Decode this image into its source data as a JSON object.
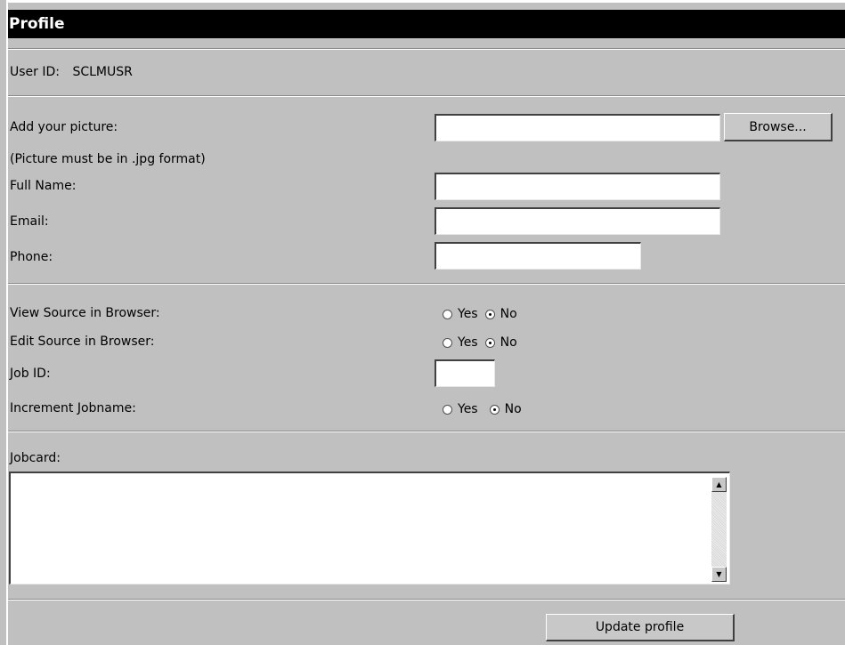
{
  "header": {
    "title": "Profile"
  },
  "user": {
    "id_label": "User ID:",
    "id_value": "SCLMUSR"
  },
  "picture": {
    "label": "Add your picture:",
    "note": "(Picture must be in .jpg format)",
    "value": "",
    "browse_label": "Browse..."
  },
  "fields": {
    "full_name_label": "Full Name:",
    "full_name_value": "",
    "email_label": "Email:",
    "email_value": "",
    "phone_label": "Phone:",
    "phone_value": ""
  },
  "options": {
    "view_source": {
      "label": "View Source in Browser:",
      "yes": "Yes",
      "no": "No",
      "selected": "No"
    },
    "edit_source": {
      "label": "Edit Source in Browser:",
      "yes": "Yes",
      "no": "No",
      "selected": "No"
    },
    "job_id": {
      "label": "Job ID:",
      "value": ""
    },
    "increment_jobname": {
      "label": "Increment Jobname:",
      "yes": "Yes",
      "no": "No",
      "selected": "No"
    }
  },
  "jobcard": {
    "label": "Jobcard:",
    "value": ""
  },
  "actions": {
    "update_label": "Update profile"
  },
  "icons": {
    "scroll_up": "▲",
    "scroll_down": "▼"
  }
}
